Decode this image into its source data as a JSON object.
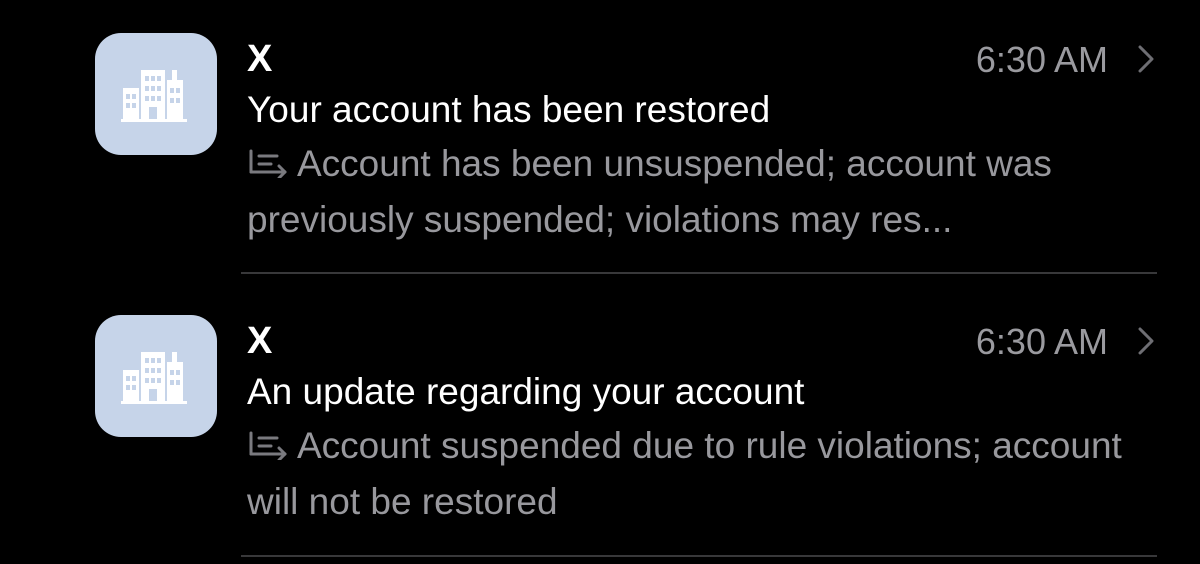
{
  "colors": {
    "background": "#000000",
    "avatar_bg": "#c6d4e9",
    "primary_text": "#ffffff",
    "secondary_text": "#98989d",
    "divider": "#38383a"
  },
  "messages": [
    {
      "avatar_icon": "building-icon",
      "sender": "X",
      "time": "6:30 AM",
      "subject": "Your account has been restored",
      "summary_icon": "summary-icon",
      "preview": "Account has been unsuspended; account was previously suspended; violations may res..."
    },
    {
      "avatar_icon": "building-icon",
      "sender": "X",
      "time": "6:30 AM",
      "subject": "An update regarding your account",
      "summary_icon": "summary-icon",
      "preview": "Account suspended due to rule violations; account will not be restored"
    }
  ]
}
